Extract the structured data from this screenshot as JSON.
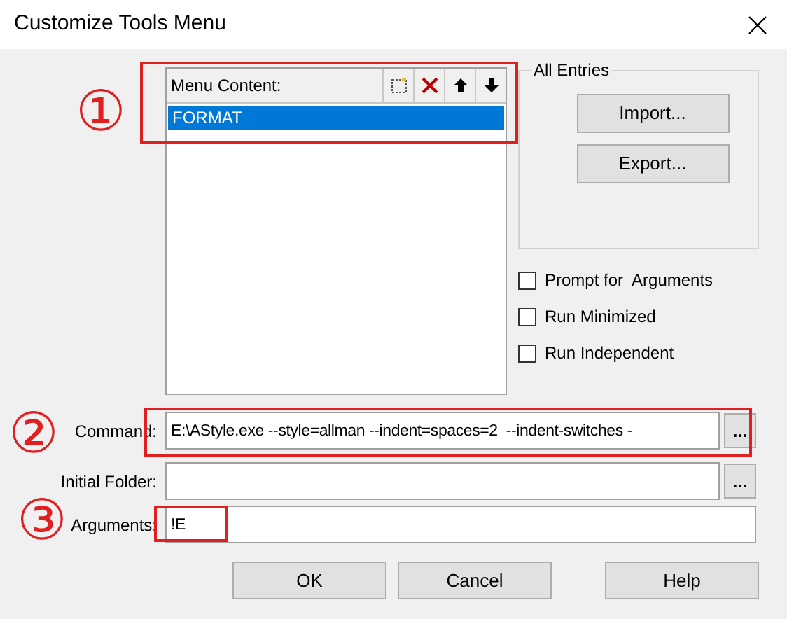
{
  "window": {
    "title": "Customize Tools Menu"
  },
  "menu_content": {
    "label": "Menu Content:",
    "items": [
      {
        "label": "FORMAT",
        "selected": true
      }
    ]
  },
  "all_entries": {
    "title": "All Entries",
    "buttons": [
      "Import...",
      "Export..."
    ]
  },
  "options": [
    {
      "label": "Prompt for  Arguments",
      "checked": false
    },
    {
      "label": "Run Minimized",
      "checked": false
    },
    {
      "label": "Run Independent",
      "checked": false
    }
  ],
  "fields": [
    {
      "label": "Command:",
      "value": "E:\\AStyle.exe --style=allman --indent=spaces=2  --indent-switches -",
      "browse": "..."
    },
    {
      "label": "Initial Folder:",
      "browse": "..."
    },
    {
      "label": "Arguments:",
      "value": "!E"
    }
  ],
  "buttons": [
    "OK",
    "Cancel",
    "Help"
  ],
  "annotations": [
    {
      "number": "①"
    },
    {
      "number": "②"
    },
    {
      "number": "③"
    }
  ]
}
